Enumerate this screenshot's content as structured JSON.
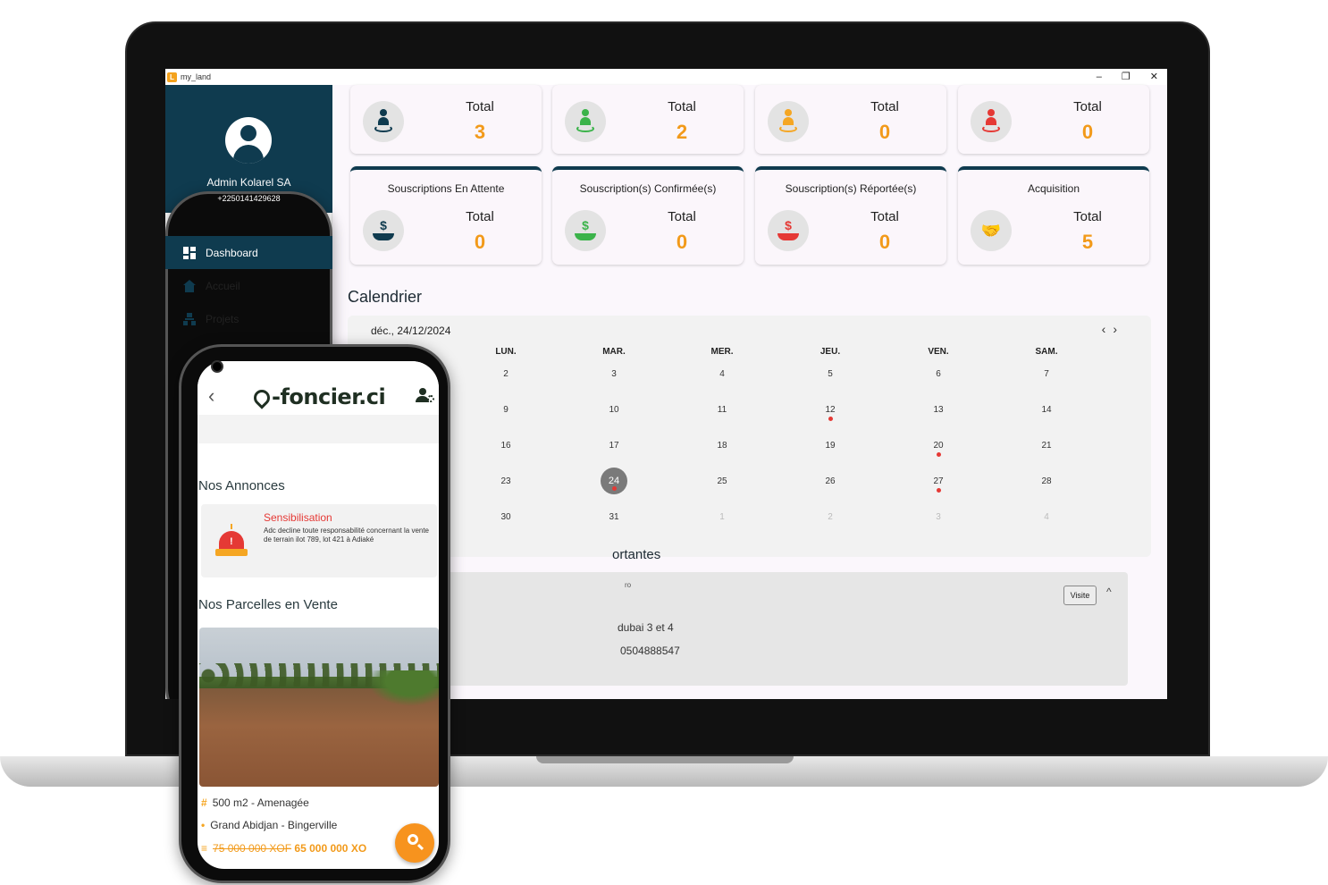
{
  "window": {
    "title": "my_land",
    "min": "–",
    "max": "❐",
    "close": "✕"
  },
  "profile": {
    "name": "Admin Kolarel SA",
    "phone": "+2250141429628"
  },
  "nav": [
    {
      "label": "Dashboard",
      "icon": "dashboard-icon",
      "active": true
    },
    {
      "label": "Accueil",
      "icon": "home-icon"
    },
    {
      "label": "Projets",
      "icon": "sitemap-icon"
    }
  ],
  "stats_top": [
    {
      "label": "Total",
      "value": "3",
      "icon": "person-pin-icon",
      "color": "#0f3b4f"
    },
    {
      "label": "Total",
      "value": "2",
      "icon": "person-pin-icon",
      "color": "#3bb34a"
    },
    {
      "label": "Total",
      "value": "0",
      "icon": "person-pin-icon",
      "color": "#f5a623"
    },
    {
      "label": "Total",
      "value": "0",
      "icon": "person-pin-icon",
      "color": "#e53935"
    }
  ],
  "stats_bottom": [
    {
      "title": "Souscriptions En Attente",
      "label": "Total",
      "value": "0",
      "icon": "dollar-hand-icon",
      "color": "#0f3b4f"
    },
    {
      "title": "Souscription(s) Confirmée(s)",
      "label": "Total",
      "value": "0",
      "icon": "dollar-hand-icon",
      "color": "#3bb34a"
    },
    {
      "title": "Souscription(s) Réportée(s)",
      "label": "Total",
      "value": "0",
      "icon": "dollar-hand-icon",
      "color": "#e53935"
    },
    {
      "title": "Acquisition",
      "label": "Total",
      "value": "5",
      "icon": "handshake-icon",
      "color": "#0f3b4f"
    }
  ],
  "accent_value_color": "#f29a1a",
  "calendar": {
    "title": "Calendrier",
    "header": "déc., 24/12/2024",
    "prev": "‹",
    "next": "›",
    "weekdays": [
      "LUN.",
      "MAR.",
      "MER.",
      "JEU.",
      "VEN.",
      "SAM."
    ],
    "weeks": [
      [
        {
          "d": "2"
        },
        {
          "d": "3"
        },
        {
          "d": "4"
        },
        {
          "d": "5"
        },
        {
          "d": "6"
        },
        {
          "d": "7"
        }
      ],
      [
        {
          "d": "9"
        },
        {
          "d": "10"
        },
        {
          "d": "11"
        },
        {
          "d": "12",
          "event": true
        },
        {
          "d": "13"
        },
        {
          "d": "14"
        }
      ],
      [
        {
          "d": "16"
        },
        {
          "d": "17"
        },
        {
          "d": "18"
        },
        {
          "d": "19"
        },
        {
          "d": "20",
          "event": true
        },
        {
          "d": "21"
        }
      ],
      [
        {
          "d": "23"
        },
        {
          "d": "24",
          "today": true,
          "event": true
        },
        {
          "d": "25"
        },
        {
          "d": "26"
        },
        {
          "d": "27",
          "event": true
        },
        {
          "d": "28"
        }
      ],
      [
        {
          "d": "30"
        },
        {
          "d": "31"
        },
        {
          "d": "1",
          "muted": true
        },
        {
          "d": "2",
          "muted": true
        },
        {
          "d": "3",
          "muted": true
        },
        {
          "d": "4",
          "muted": true
        }
      ]
    ]
  },
  "important": {
    "title_fragment": "ortantes",
    "small": "ro",
    "line1": "dubai 3 et 4",
    "line2": "0504888547",
    "button": "Visite",
    "collapse": "^"
  },
  "phone": {
    "back": "‹",
    "logo": "-foncier.ci",
    "section_annonces": "Nos Annonces",
    "notice_title": "Sensibilisation",
    "notice_text": "Adc decline toute responsabilité concernant la vente de terrain ilot 789, lot 421 à Adiaké",
    "section_parcelles": "Nos Parcelles en Vente",
    "parcel": {
      "size": "500 m2 - Amenagée",
      "location": "Grand Abidjan - Bingerville",
      "old_price": "75 000 000 XOF",
      "new_price": "65 000 000 XO"
    }
  }
}
